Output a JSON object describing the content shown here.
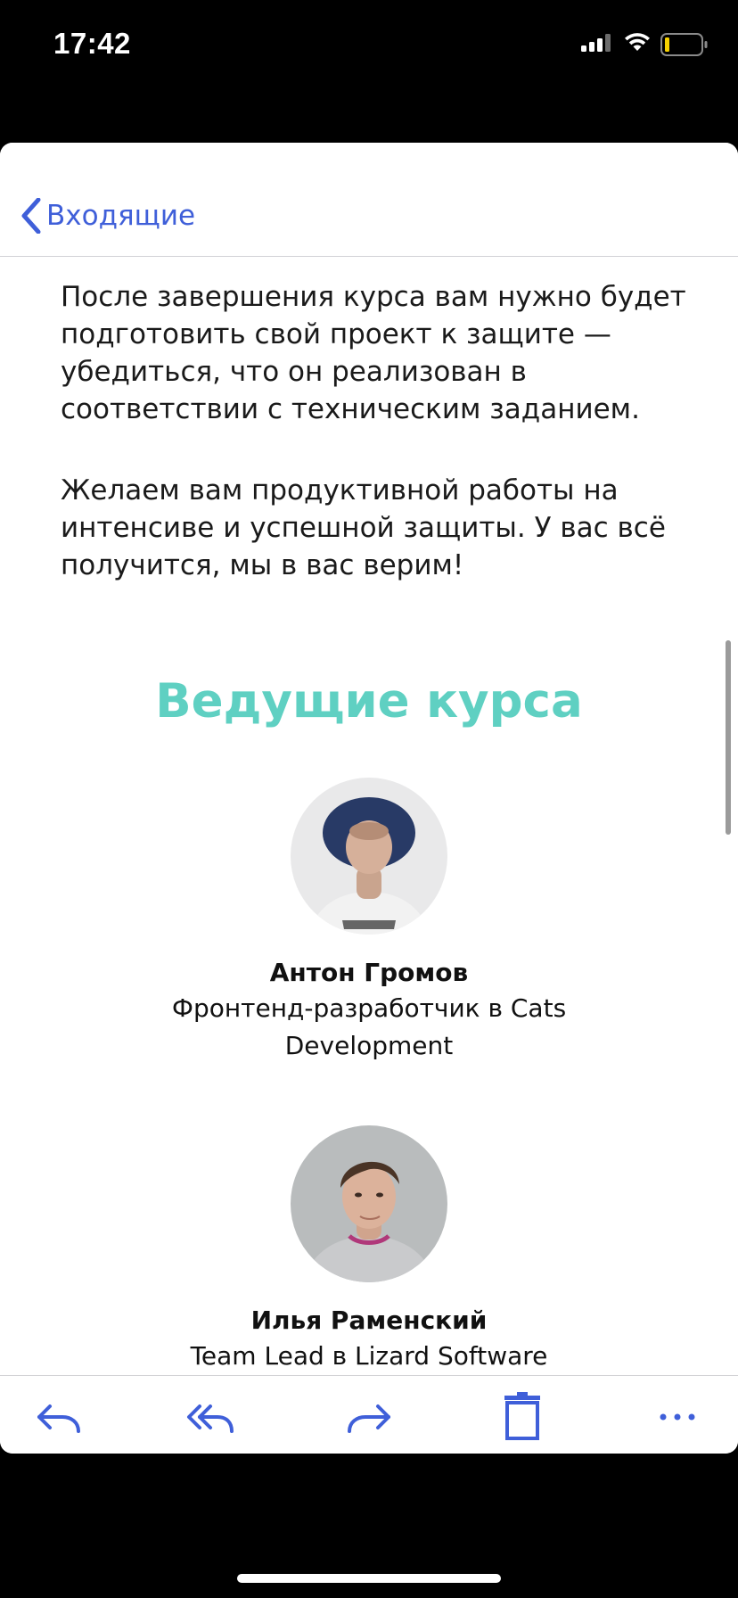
{
  "status_bar": {
    "time": "17:42",
    "signal_icon": "cellular-signal-icon",
    "wifi_icon": "wifi-icon",
    "battery_icon": "battery-low-icon"
  },
  "nav": {
    "back_label": "Входящие",
    "back_icon": "chevron-left-icon",
    "accent_color": "#3f5fd9"
  },
  "body": {
    "paragraphs": [
      "После завершения курса вам нужно будет подготовить свой проект к защите — убедиться, что он реализован в соответствии с техническим заданием.",
      "Желаем вам продуктивной работы на интенсиве и успешной защиты. У вас всё получится, мы в вас верим!"
    ]
  },
  "section": {
    "title": "Ведущие курса",
    "title_color": "#5fd0c2"
  },
  "speakers": [
    {
      "name": "Антон Громов",
      "role": "Фронтенд-разработчик в Cats Development"
    },
    {
      "name": "Илья Раменский",
      "role": "Team Lead в Lizard Software"
    }
  ],
  "toolbar": {
    "buttons": [
      {
        "icon": "reply-icon"
      },
      {
        "icon": "reply-all-icon"
      },
      {
        "icon": "forward-icon"
      },
      {
        "icon": "trash-icon"
      },
      {
        "icon": "more-icon"
      }
    ]
  }
}
